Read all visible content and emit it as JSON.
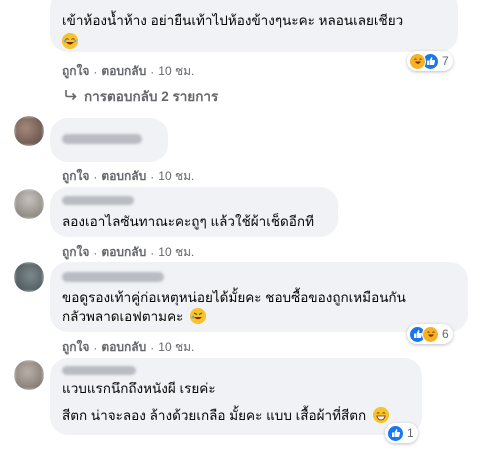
{
  "comments": [
    {
      "lines": [
        "เข้าห้องน้ำห้าง อย่ายืนเท้าไปห้องข้างๆนะคะ หลอนเลยเชียว"
      ],
      "like_label": "ถูกใจ",
      "reply_label": "ตอบกลับ",
      "time": "10 ชม.",
      "reactions": {
        "types": [
          "haha-icon",
          "like-icon"
        ],
        "count": "7"
      }
    },
    {
      "lines": [],
      "like_label": "ถูกใจ",
      "reply_label": "ตอบกลับ",
      "time": "10 ชม."
    },
    {
      "lines": [
        "ลองเอาไลซันทาณะคะถูๆ แล้วใช้ผ้าเช็ดอีกที"
      ],
      "like_label": "ถูกใจ",
      "reply_label": "ตอบกลับ",
      "time": "10 ชม."
    },
    {
      "lines": [
        "ขอดูรองเท้าคู่ก่อเหตุหน่อยได้มั้ยคะ ชอบซื้อของถูกเหมือนกัน",
        "กลัวพลาดเอฟตามคะ"
      ],
      "like_label": "ถูกใจ",
      "reply_label": "ตอบกลับ",
      "time": "10 ชม.",
      "reactions": {
        "types": [
          "like-icon",
          "haha-icon"
        ],
        "count": "6"
      }
    },
    {
      "lines": [
        "แวบแรกนึกถึงหนังผี เรยค่ะ",
        "สีตก น่าจะลอง ล้างด้วยเกลือ มั้ยคะ แบบ เสื้อผ้าที่สีตก"
      ],
      "reactions": {
        "types": [
          "like-icon"
        ],
        "count": "1"
      }
    }
  ],
  "view_replies": "การตอบกลับ 2 รายการ",
  "separator": "·",
  "colors": {
    "bubble": "#f0f2f5",
    "secondary_text": "#65676b",
    "like_blue": "#1877f2",
    "haha_yellow": "#f7b125"
  }
}
